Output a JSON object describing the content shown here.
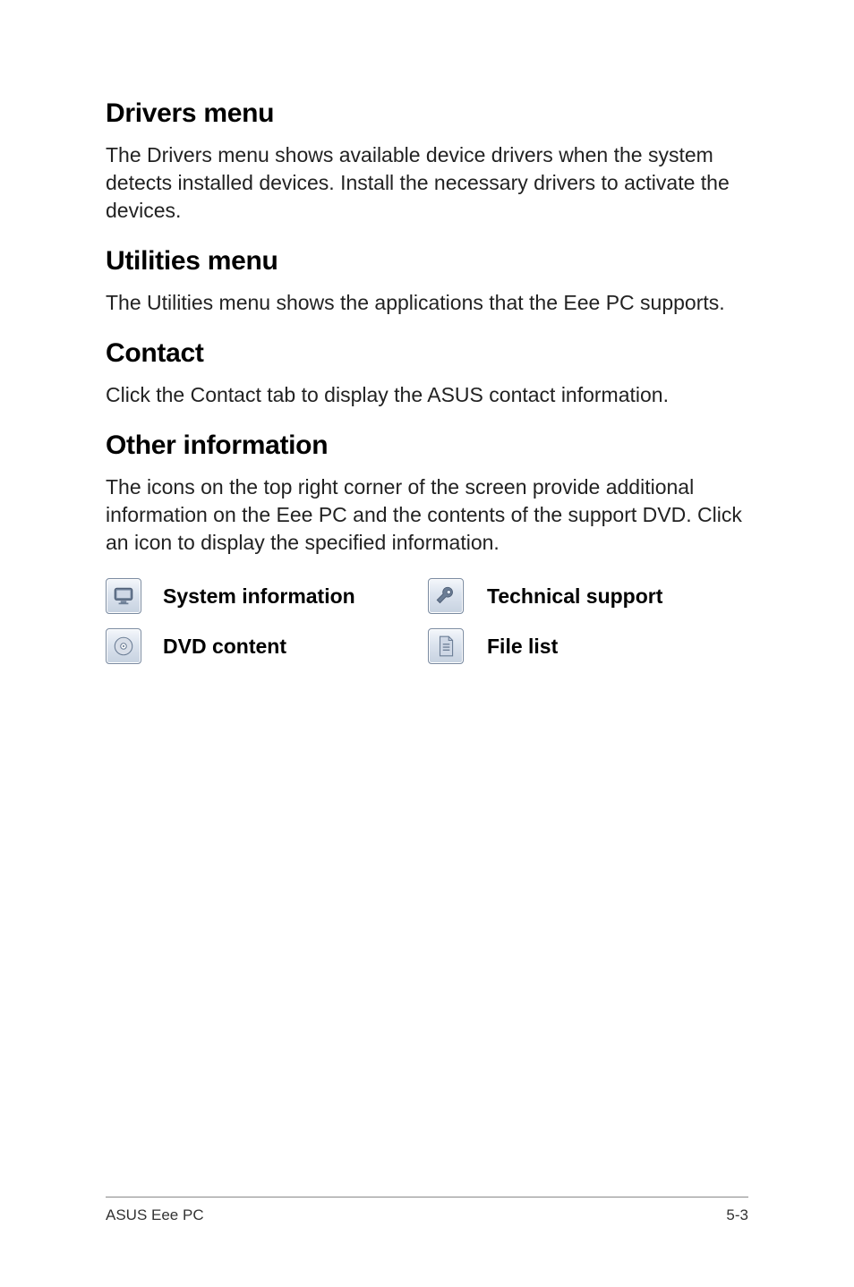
{
  "sections": {
    "drivers": {
      "heading": "Drivers menu",
      "body": "The Drivers menu shows available device drivers when the system detects installed devices. Install the necessary drivers to activate the devices."
    },
    "utilities": {
      "heading": "Utilities menu",
      "body": "The Utilities menu shows the applications that the Eee PC supports."
    },
    "contact": {
      "heading": "Contact",
      "body": "Click the Contact tab to display the ASUS contact information."
    },
    "other": {
      "heading": "Other information",
      "body": "The icons on the top right corner of the screen provide additional information on the Eee PC and the contents of the support DVD. Click an icon to display the specified information."
    }
  },
  "info_items": {
    "system_info": "System information",
    "tech_support": "Technical support",
    "dvd_content": "DVD content",
    "file_list": "File list"
  },
  "footer": {
    "left": "ASUS Eee PC",
    "right": "5-3"
  }
}
